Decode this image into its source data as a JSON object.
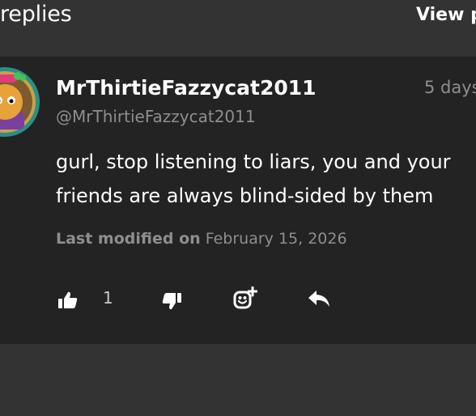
{
  "header": {
    "title": "replies",
    "link": "View p"
  },
  "comment": {
    "username": "MrThirtieFazzycat2011",
    "handle": "@MrThirtieFazzycat2011",
    "timestamp": "5 days",
    "body_line1": "gurl, stop listening to liars, you and your",
    "body_line2": "friends are always blind-sided by them",
    "modified_label": "Last modified on",
    "modified_date": "February 15, 2026",
    "like_count": "1"
  },
  "icons": {
    "like": "thumbs-up-icon",
    "dislike": "thumbs-down-icon",
    "react": "add-reaction-icon",
    "reply": "reply-icon"
  },
  "colors": {
    "page_background": "#333333",
    "card_background": "#222322",
    "text_primary": "#ffffff",
    "text_secondary": "#8e8e8e"
  }
}
